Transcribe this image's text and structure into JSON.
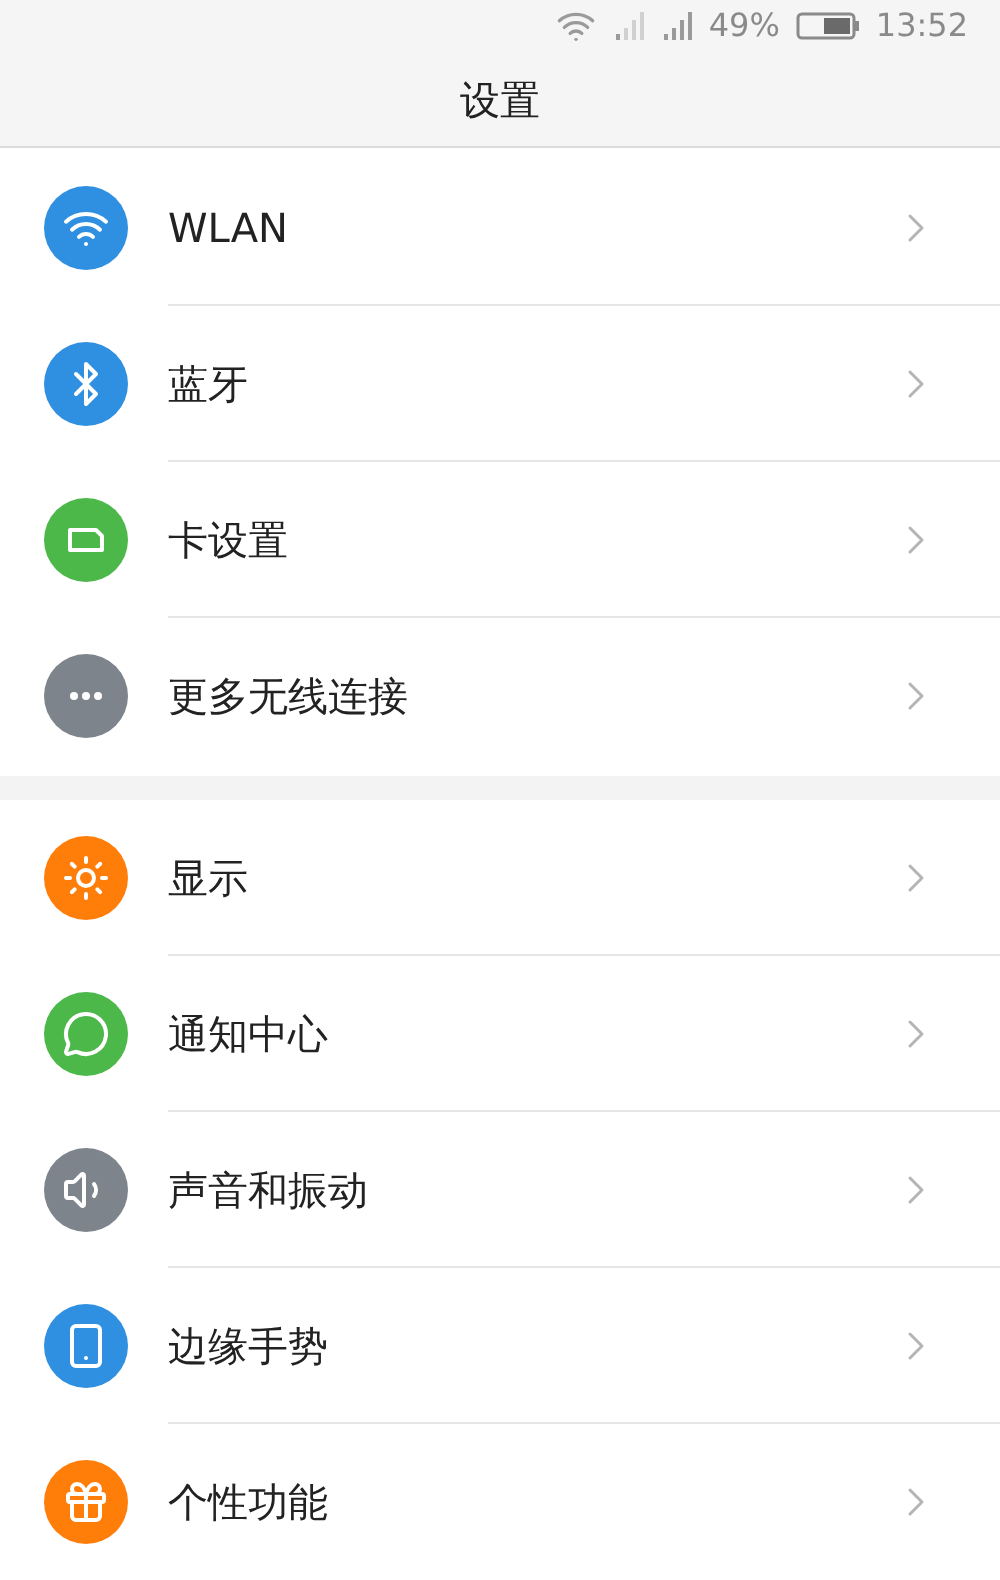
{
  "status_bar": {
    "battery": "49%",
    "time": "13:52"
  },
  "header": {
    "title": "设置"
  },
  "groups": [
    {
      "items": [
        {
          "label": "WLAN",
          "kind": "wifi",
          "color": "#2f8fe0"
        },
        {
          "label": "蓝牙",
          "kind": "bluetooth",
          "color": "#2f8fe0"
        },
        {
          "label": "卡设置",
          "kind": "sim",
          "color": "#4cb84a"
        },
        {
          "label": "更多无线连接",
          "kind": "more",
          "color": "#7d848c"
        }
      ]
    },
    {
      "items": [
        {
          "label": "显示",
          "kind": "display",
          "color": "#ff7e0a"
        },
        {
          "label": "通知中心",
          "kind": "message",
          "color": "#4cb84a"
        },
        {
          "label": "声音和振动",
          "kind": "sound",
          "color": "#7d848c"
        },
        {
          "label": "边缘手势",
          "kind": "edge",
          "color": "#2f8fe0"
        },
        {
          "label": "个性功能",
          "kind": "feature",
          "color": "#ff7e0a"
        }
      ]
    }
  ]
}
